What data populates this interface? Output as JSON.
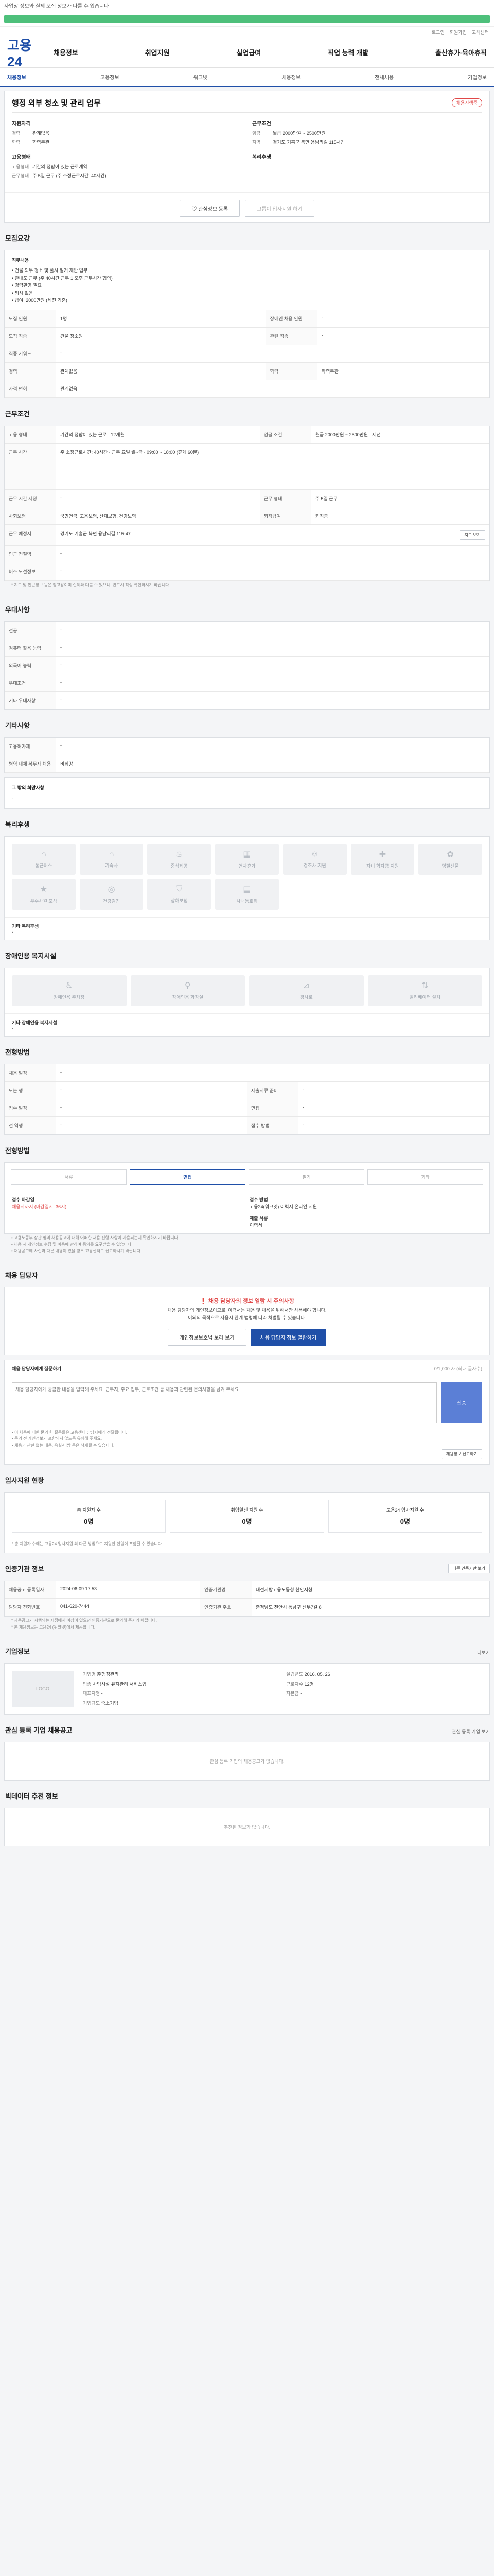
{
  "topbar": {
    "notice": "사업장 정보와 실제 모집 정보가 다를 수 있습니다"
  },
  "progress": {
    "percent": 100,
    "label": ""
  },
  "util": [
    "로그인",
    "회원가입",
    "고객센터"
  ],
  "header": {
    "logo": "고용24",
    "menu": [
      "채용정보",
      "취업지원",
      "실업급여",
      "직업 능력 개발",
      "출산휴가·육아휴직"
    ]
  },
  "subnav": {
    "items": [
      "채용정보",
      "고용정보",
      "워크넷",
      "채용정보",
      "전체채용",
      "기업정보"
    ],
    "active_index": 0
  },
  "job": {
    "title": "행정 외부 청소 및 관리 업무",
    "badge": "채용진행중",
    "left": {
      "title1": "자원자격",
      "rows1": [
        {
          "k": "경력",
          "v": "관계없음"
        },
        {
          "k": "학력",
          "v": "학력무관"
        }
      ],
      "title2": "고용형태",
      "rows2": [
        {
          "k": "고용형태",
          "v": "기간의 정함이 있는 근로계약"
        },
        {
          "k": "근무형태",
          "v": "주 5일 근무 (주 소정근로시간: 40시간)"
        }
      ]
    },
    "right": {
      "title1": "근무조건",
      "rows1": [
        {
          "k": "임금",
          "v": "월급 2000만원 ~ 2500만원"
        },
        {
          "k": "지역",
          "v": "경기도 기흥군 북면 용남리길 115-47"
        }
      ],
      "title2": "복리후생",
      "rows2": []
    },
    "actions": {
      "interest": "관심정보 등록",
      "apply": "그룹이 입사지원 하기"
    }
  },
  "recruit": {
    "title": "모집요강",
    "box_title": "직무내용",
    "box_lines": [
      "• 건물 외부 청소 및 풀시 철거 제반 업무",
      "• 관내도 근무 (주 40시간 근무 1 오후 근무시간 협의)",
      "• 경력환영 필요",
      "• 퇴사 없음",
      "• 급여: 2000만원 (세전 기준)"
    ],
    "rows": [
      {
        "k": "모집 인원",
        "v": "1명",
        "k2": "장애인 채용 인원",
        "v2": "-"
      },
      {
        "k": "모집 직종",
        "v": "건물 청소원",
        "k2": "관련 직종",
        "v2": "-"
      },
      {
        "k": "직종 키워드",
        "v": "-",
        "k2": "",
        "v2": ""
      },
      {
        "k": "경력",
        "v": "관계없음",
        "k2": "학력",
        "v2": "학력무관"
      },
      {
        "k": "자격 면허",
        "v": "관계없음",
        "k2": "",
        "v2": ""
      }
    ]
  },
  "conditions": {
    "title": "근무조건",
    "rows": [
      {
        "k": "고용 형태",
        "v": "기간의 정함이 있는 근로 · 12개월",
        "k2": "임금 조건",
        "v2": "월급 2000만원 ~ 2500만원 · 세전"
      },
      {
        "k": "근무 시간",
        "v": "주 소정근로시간: 40시간 · 근무 요일 월~금 · 09:00 ~ 18:00 (휴게 60분)",
        "k2": "",
        "v2": ""
      },
      {
        "k": "근무 시간 지정",
        "v": "-",
        "k2": "근무 형태",
        "v2": "주 5일 근무"
      },
      {
        "k": "사회보험",
        "v": "국민연금, 고용보험, 산재보험, 건강보험",
        "k2": "퇴직급여",
        "v2": "퇴직금"
      },
      {
        "k": "근무 예정지",
        "v": "경기도 기흥군 북면 용남리길 115-47",
        "k2": "",
        "v2": ""
      },
      {
        "k": "인근 전철역",
        "v": "-",
        "k2": "",
        "v2": ""
      },
      {
        "k": "버스 노선정보",
        "v": "-",
        "k2": "",
        "v2": ""
      }
    ],
    "map_button": "지도 보기",
    "note": "* 지도 및 인근정보 등은 참고용이며 실제와 다를 수 있으니, 반드시 직접 확인하시기 바랍니다."
  },
  "preference": {
    "title": "우대사항",
    "rows": [
      {
        "k": "전공",
        "v": "-"
      },
      {
        "k": "컴퓨터 활용 능력",
        "v": "-"
      },
      {
        "k": "외국어 능력",
        "v": "-"
      },
      {
        "k": "우대조건",
        "v": "-"
      },
      {
        "k": "기타 우대사항",
        "v": "-"
      }
    ]
  },
  "other": {
    "title": "기타사항",
    "rows": [
      {
        "k": "고용허가제",
        "v": "-"
      },
      {
        "k": "병역 대체 복무자 채용",
        "v": "비희망"
      }
    ],
    "note_title": "그 밖의 희망사항",
    "note_value": "-"
  },
  "welfare": {
    "title": "복리후생",
    "icons": [
      {
        "name": "house-icon",
        "glyph": "⌂",
        "label": "통근버스"
      },
      {
        "name": "home-icon",
        "glyph": "⌂",
        "label": "기숙사"
      },
      {
        "name": "meal-icon",
        "glyph": "♨",
        "label": "중식제공"
      },
      {
        "name": "calendar-icon",
        "glyph": "▦",
        "label": "연차휴가"
      },
      {
        "name": "child-icon",
        "glyph": "☺",
        "label": "경조사 지원"
      },
      {
        "name": "health-icon",
        "glyph": "✚",
        "label": "자녀 학자금 지원"
      },
      {
        "name": "gift-icon",
        "glyph": "✿",
        "label": "명절선물"
      },
      {
        "name": "trophy-icon",
        "glyph": "★",
        "label": "우수사원 포상"
      },
      {
        "name": "glasses-icon",
        "glyph": "◎",
        "label": "건강검진"
      },
      {
        "name": "shield-icon",
        "glyph": "⛉",
        "label": "상해보험"
      },
      {
        "name": "chart-icon",
        "glyph": "▤",
        "label": "사내동호회"
      }
    ],
    "etc_title": "기타 복리후생",
    "etc_value": "-"
  },
  "disability": {
    "title": "장애인용 복지시설",
    "icons": [
      {
        "name": "wheelchair-icon",
        "glyph": "♿",
        "label": "장애인용 주차장"
      },
      {
        "name": "restroom-icon",
        "glyph": "⚲",
        "label": "장애인용 화장실"
      },
      {
        "name": "ramp-icon",
        "glyph": "⊿",
        "label": "경사로"
      },
      {
        "name": "elevator-icon",
        "glyph": "⇅",
        "label": "엘리베이터 설치"
      }
    ],
    "etc_title": "기타 장애인용 복지시설",
    "etc_value": "-"
  },
  "selection": {
    "title": "전형방법",
    "rows": [
      {
        "k": "채용 일정",
        "v": "-",
        "k2": "",
        "v2": ""
      },
      {
        "k": "모는 행",
        "v": "-",
        "k2": "제출서류 준비",
        "v2": "-"
      },
      {
        "k": "접수 일정",
        "v": "-",
        "k2": "면접",
        "v2": "-"
      },
      {
        "k": "전 역행",
        "v": "-",
        "k2": "접수 방법",
        "v2": "-"
      }
    ]
  },
  "apply_method": {
    "title": "전형방법",
    "tabs": [
      "서류",
      "면접",
      "필기",
      "기타"
    ],
    "active": 1,
    "left_label": "접수 마감일",
    "left_value": "채용시까지 (마감일시: 36시)",
    "right_label": "접수 방법",
    "right_value": "고용24(워크넷) 이력서 온라인 지원",
    "docs_label": "제출 서류",
    "docs_value": "이력서",
    "notes": [
      "• 고용노동부 장관 명의 채용공고에 대해 어떠한 채용 진행 사항이 사용되는지 확인하시기 바랍니다.",
      "• 채용 시 개인정보 수집 및 이용에 관하여 동의를 요구받을 수 있습니다.",
      "• 채용공고에 사실과 다른 내용이 있을 경우 고용센터로 신고하시기 바랍니다."
    ]
  },
  "contact": {
    "title": "채용 담당자",
    "alert_title": "채용 담당자의 정보 열람 시 주의사항",
    "alert_lines": [
      "채용 담당자의 개인정보이므로, 이력서는 채용 및 채용을 위해서만 사용해야 합니다.",
      "이외의 목적으로 사용시 관계 법령에 따라 처벌될 수 있습니다."
    ],
    "btn_privacy": "개인정보보호법 보러 보기",
    "btn_view": "채용 담당자 정보 열람하기"
  },
  "question": {
    "title": "채용 담당자에게 질문하기",
    "counter": "0/1,000 자 (최대 글자수)",
    "placeholder": "채용 담당자에게 궁금한 내용을 입력해 주세요. 근무지, 주요 업무, 근로조건 등 채용과 관련된 문의사항을 남겨 주세요.",
    "send": "전송",
    "notes": [
      "• 이 채용에 대한 문의 한 질문들은 고용센터 담당자에게 전달됩니다.",
      "• 문의 전 개인정보가 포함되지 않도록 유의해 주세요.",
      "• 채용과 관련 없는 내용, 욕설·비방 등은 삭제될 수 있습니다."
    ],
    "report": "채용정보 신고하기"
  },
  "status": {
    "title": "입사지원 현황",
    "items": [
      {
        "label": "총 지원자 수",
        "value": "0명"
      },
      {
        "label": "취업알선 지원 수",
        "value": "0명"
      },
      {
        "label": "고용24 입사지원 수",
        "value": "0명"
      }
    ],
    "note": "* 총 지원자 수에는 고용24 입사지원 외 다른 방법으로 지원한 인원이 포함될 수 있습니다."
  },
  "institution": {
    "title": "인증기관 정보",
    "btn": "다른 인증기관 보기",
    "rows": [
      {
        "k": "채용공고 등록일자",
        "v": "2024-06-09 17:53",
        "k2": "인증기관명",
        "v2": "대전지방고용노동청 천안지청"
      },
      {
        "k": "담당자 전화번호",
        "v": "041-620-7444",
        "k2": "인증기관 주소",
        "v2": "충청남도 천안시 동남구 신부7길 8"
      }
    ],
    "notes": [
      "* 채용공고가 시행되는 시점에서 이상이 있으면 인증기관으로 문의해 주시기 바랍니다.",
      "* 본 채용정보는 고용24 (워크넷)에서 제공합니다."
    ]
  },
  "company": {
    "title": "기업정보",
    "more": "더보기",
    "logo_text": "LOGO",
    "rows": [
      {
        "k": "기업명",
        "v": "㈜행정관리",
        "k2": "설립년도",
        "v2": "2016. 05. 26"
      },
      {
        "k": "업종",
        "v": "사업시설 유지관리 서비스업",
        "k2": "근로자수",
        "v2": "12명"
      },
      {
        "k": "대표자명",
        "v": "-",
        "k2": "자본금",
        "v2": "-"
      },
      {
        "k": "기업규모",
        "v": "중소기업",
        "k2": "",
        "v2": ""
      }
    ]
  },
  "similar": {
    "title": "관심 등록 기업 채용공고",
    "more": "관심 등록 기업 보기",
    "empty": "관심 등록 기업의 채용공고가 없습니다."
  },
  "recommend": {
    "title": "빅데이터 추천 정보",
    "empty": "추천된 정보가 없습니다."
  }
}
